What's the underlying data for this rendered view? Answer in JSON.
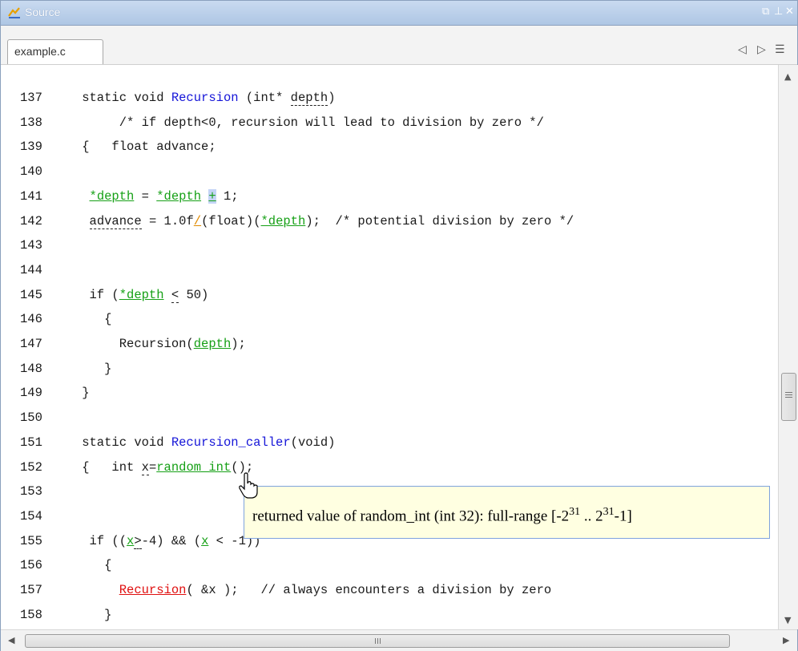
{
  "window": {
    "title": "Source"
  },
  "tabs": [
    {
      "label": "example.c"
    }
  ],
  "code_lines": [
    {
      "num": "137",
      "parts": [
        {
          "t": "    static void "
        },
        {
          "t": "Recursion",
          "c": "blue"
        },
        {
          "t": " (int* "
        },
        {
          "t": "depth",
          "c": "dash"
        },
        {
          "t": ")"
        }
      ]
    },
    {
      "num": "138",
      "parts": [
        {
          "t": "         /* if depth<0, recursion will lead to division by zero */"
        }
      ]
    },
    {
      "num": "139",
      "parts": [
        {
          "t": "    {   float advance;"
        }
      ]
    },
    {
      "num": "140",
      "parts": []
    },
    {
      "num": "141",
      "parts": [
        {
          "t": "     "
        },
        {
          "t": "*depth",
          "c": "grn"
        },
        {
          "t": " = "
        },
        {
          "t": "*depth",
          "c": "grn"
        },
        {
          "t": " "
        },
        {
          "t": "+",
          "c": "hl grn"
        },
        {
          "t": " 1;"
        }
      ]
    },
    {
      "num": "142",
      "parts": [
        {
          "t": "     "
        },
        {
          "t": "advance",
          "c": "dash"
        },
        {
          "t": " = 1.0f"
        },
        {
          "t": "/",
          "c": "orange"
        },
        {
          "t": "(float)("
        },
        {
          "t": "*depth",
          "c": "grn"
        },
        {
          "t": ");  /* potential division by zero */"
        }
      ]
    },
    {
      "num": "143",
      "parts": []
    },
    {
      "num": "144",
      "parts": []
    },
    {
      "num": "145",
      "parts": [
        {
          "t": "     if ("
        },
        {
          "t": "*depth",
          "c": "grn"
        },
        {
          "t": " "
        },
        {
          "t": "<",
          "c": "dash"
        },
        {
          "t": " 50)"
        }
      ]
    },
    {
      "num": "146",
      "parts": [
        {
          "t": "       {"
        }
      ]
    },
    {
      "num": "147",
      "parts": [
        {
          "t": "         Recursion("
        },
        {
          "t": "depth",
          "c": "grn"
        },
        {
          "t": ");"
        }
      ]
    },
    {
      "num": "148",
      "parts": [
        {
          "t": "       }"
        }
      ]
    },
    {
      "num": "149",
      "parts": [
        {
          "t": "    }"
        }
      ]
    },
    {
      "num": "150",
      "parts": []
    },
    {
      "num": "151",
      "parts": [
        {
          "t": "    static void "
        },
        {
          "t": "Recursion_caller",
          "c": "blue"
        },
        {
          "t": "(void)"
        }
      ]
    },
    {
      "num": "152",
      "parts": [
        {
          "t": "    {   int "
        },
        {
          "t": "x",
          "c": "dash"
        },
        {
          "t": "="
        },
        {
          "t": "random_int",
          "c": "grn"
        },
        {
          "t": "();"
        }
      ]
    },
    {
      "num": "153",
      "parts": []
    },
    {
      "num": "154",
      "parts": []
    },
    {
      "num": "155",
      "parts": [
        {
          "t": "     if (("
        },
        {
          "t": "x",
          "c": "grn"
        },
        {
          "t": ">",
          "c": "dash"
        },
        {
          "t": "-4) && ("
        },
        {
          "t": "x",
          "c": "grn"
        },
        {
          "t": " < -1))"
        }
      ]
    },
    {
      "num": "156",
      "parts": [
        {
          "t": "       {"
        }
      ]
    },
    {
      "num": "157",
      "parts": [
        {
          "t": "         "
        },
        {
          "t": "Recursion",
          "c": "red"
        },
        {
          "t": "( &x );   // always encounters a division by zero"
        }
      ]
    },
    {
      "num": "158",
      "parts": [
        {
          "t": "       }"
        }
      ]
    }
  ],
  "tooltip": {
    "text_prefix": "returned value of random_int (int 32): full-range [-2",
    "exp1": "31",
    "mid": " .. 2",
    "exp2": "31",
    "suffix": "-1]"
  },
  "colors": {
    "keyword_blue": "#1515d8",
    "proven_green": "#16a016",
    "error_red": "#e01010",
    "warning_orange": "#e08a00",
    "tooltip_bg": "#ffffe1"
  }
}
